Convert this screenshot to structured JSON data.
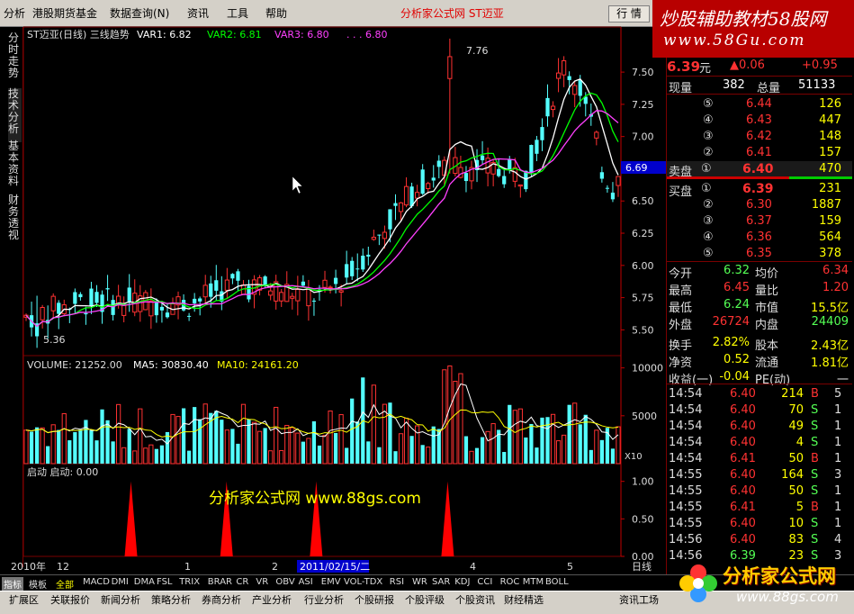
{
  "menu": {
    "items": [
      "分析",
      "港股期货基金",
      "数据查询(N)",
      "资讯",
      "工具",
      "帮助"
    ],
    "center_title": "分析家公式网 ST迈亚",
    "hq_button": "行 情"
  },
  "watermark_top": {
    "line1": "炒股辅助教材58股网",
    "line2": "www.58Gu.com"
  },
  "watermark_bottom": {
    "line1": "分析家公式网",
    "line2": "www.88gs.com"
  },
  "left_tabs": [
    "分时走势",
    "技术分析",
    "基本资料",
    "财务透视"
  ],
  "main_chart": {
    "title": "ST迈亚(日线) 三线趋势",
    "var1_label": "VAR1: 6.82",
    "var2_label": "VAR2: 6.81",
    "var3_label": "VAR3: 6.80",
    "var4_label": ". . . 6.80",
    "high_label": "7.76",
    "low_label": "5.36",
    "current_price_tag": "6.69"
  },
  "vol_panel": {
    "title": "VOLUME: 21252.00",
    "ma5": "MA5: 30830.40",
    "ma10": "MA10: 24161.20",
    "scale_label": "X10"
  },
  "ind_panel": {
    "title": "启动  启动: 0.00",
    "watermark": "分析家公式网  www.88gs.com"
  },
  "date_axis": {
    "labels": [
      "2010年",
      "12",
      "1",
      "2",
      "2011/02/15/二",
      "4",
      "5"
    ],
    "period": "日线"
  },
  "colors": {
    "up": "#ff3232",
    "down": "#54ffff",
    "var1": "#ffffff",
    "var2": "#00ff00",
    "var3": "#ff40ff",
    "grid": "#7a0000",
    "yellow": "#ffff00"
  },
  "quote": {
    "price": "6.39",
    "unit": "元",
    "change": "▲0.06",
    "pct": "+0.95",
    "xianliang_label": "现量",
    "xianliang": "382",
    "zongliang_label": "总量",
    "zongliang": "51133",
    "sell_levels": [
      {
        "no": "⑤",
        "price": "6.44",
        "vol": "126"
      },
      {
        "no": "④",
        "price": "6.43",
        "vol": "447"
      },
      {
        "no": "③",
        "price": "6.42",
        "vol": "148"
      },
      {
        "no": "②",
        "price": "6.41",
        "vol": "157"
      },
      {
        "no": "①",
        "price": "6.40",
        "vol": "470"
      }
    ],
    "sell_label": "卖盘",
    "buy_label": "买盘",
    "buy_levels": [
      {
        "no": "①",
        "price": "6.39",
        "vol": "231"
      },
      {
        "no": "②",
        "price": "6.30",
        "vol": "1887"
      },
      {
        "no": "③",
        "price": "6.37",
        "vol": "159"
      },
      {
        "no": "④",
        "price": "6.36",
        "vol": "564"
      },
      {
        "no": "⑤",
        "price": "6.35",
        "vol": "378"
      }
    ],
    "stats": [
      {
        "l1": "今开",
        "v1": "6.32",
        "l2": "均价",
        "v2": "6.34"
      },
      {
        "l1": "最高",
        "v1": "6.45",
        "l2": "量比",
        "v2": "1.20"
      },
      {
        "l1": "最低",
        "v1": "6.24",
        "l2": "市值",
        "v2": "15.5亿"
      },
      {
        "l1": "外盘",
        "v1": "26724",
        "l2": "内盘",
        "v2": "24409"
      },
      {
        "l1": "换手",
        "v1": "2.82%",
        "l2": "股本",
        "v2": "2.43亿"
      },
      {
        "l1": "净资",
        "v1": "0.52",
        "l2": "流通",
        "v2": "1.81亿"
      },
      {
        "l1": "收益(一)",
        "v1": "-0.04",
        "l2": "PE(动)",
        "v2": "一"
      }
    ],
    "ticks": [
      {
        "t": "14:54",
        "p": "6.40",
        "v": "214",
        "s": "B",
        "n": "5"
      },
      {
        "t": "14:54",
        "p": "6.40",
        "v": "70",
        "s": "S",
        "n": "1"
      },
      {
        "t": "14:54",
        "p": "6.40",
        "v": "49",
        "s": "S",
        "n": "1"
      },
      {
        "t": "14:54",
        "p": "6.40",
        "v": "4",
        "s": "S",
        "n": "1"
      },
      {
        "t": "14:54",
        "p": "6.41",
        "v": "50",
        "s": "B",
        "n": "1"
      },
      {
        "t": "14:55",
        "p": "6.40",
        "v": "164",
        "s": "S",
        "n": "3"
      },
      {
        "t": "14:55",
        "p": "6.40",
        "v": "50",
        "s": "S",
        "n": "1"
      },
      {
        "t": "14:55",
        "p": "6.41",
        "v": "5",
        "s": "B",
        "n": "1"
      },
      {
        "t": "14:55",
        "p": "6.40",
        "v": "10",
        "s": "S",
        "n": "1"
      },
      {
        "t": "14:56",
        "p": "6.40",
        "v": "83",
        "s": "S",
        "n": "4"
      },
      {
        "t": "14:56",
        "p": "6.39",
        "v": "23",
        "s": "S",
        "n": "3"
      }
    ]
  },
  "indicator_tabs": [
    "指标",
    "模板",
    "全部",
    "MACD",
    "DMI",
    "DMA",
    "FSL",
    "TRIX",
    "BRAR",
    "CR",
    "VR",
    "OBV",
    "ASI",
    "EMV",
    "VOL-TDX",
    "RSI",
    "WR",
    "SAR",
    "KDJ",
    "CCI",
    "ROC",
    "MTM",
    "BOLL"
  ],
  "bottom_tabs": [
    "扩展区",
    "关联报价",
    "新闻分析",
    "策略分析",
    "券商分析",
    "产业分析",
    "行业分析",
    "个股研报",
    "个股评级",
    "个股资讯",
    "财经精选",
    "资讯工场"
  ],
  "chart_data": [
    {
      "type": "candlestick",
      "title": "ST迈亚(日线) 三线趋势",
      "ylim": [
        5.3,
        7.85
      ],
      "yticks": [
        5.5,
        5.75,
        6.0,
        6.25,
        6.5,
        6.75,
        7.0,
        7.25,
        7.5
      ],
      "series_names": [
        "VAR1",
        "VAR2",
        "VAR3"
      ],
      "high": 7.76,
      "low": 5.36,
      "last": 6.69
    },
    {
      "type": "bar",
      "title": "VOLUME",
      "ylim": [
        0,
        11000
      ],
      "yticks": [
        5000,
        10000
      ],
      "series_names": [
        "VOLUME",
        "MA5",
        "MA10"
      ]
    },
    {
      "type": "area",
      "title": "启动",
      "ylim": [
        0,
        1.2
      ],
      "yticks": [
        0.0,
        0.5,
        1.0
      ],
      "spike_positions": [
        0.18,
        0.34,
        0.49,
        0.71
      ],
      "spike_value": 1.0
    }
  ]
}
